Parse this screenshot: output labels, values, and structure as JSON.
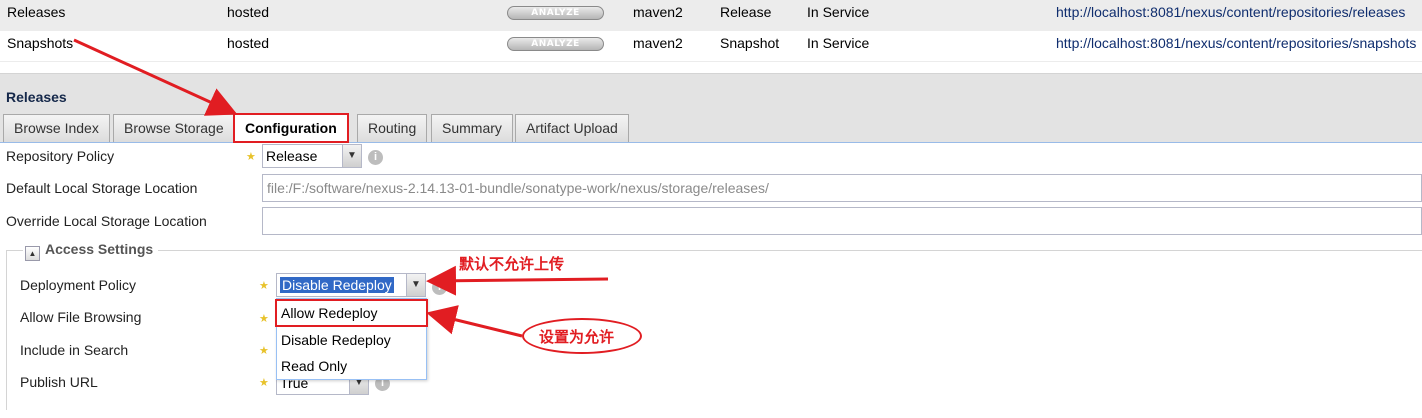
{
  "repositories": {
    "analyze_label": "ANALYZE",
    "rows": [
      {
        "name": "Releases",
        "type": "hosted",
        "format": "maven2",
        "policy": "Release",
        "status": "In Service",
        "url": "http://localhost:8081/nexus/content/repositories/releases"
      },
      {
        "name": "Snapshots",
        "type": "hosted",
        "format": "maven2",
        "policy": "Snapshot",
        "status": "In Service",
        "url": "http://localhost:8081/nexus/content/repositories/snapshots"
      }
    ]
  },
  "panel": {
    "title": "Releases",
    "tabs": [
      "Browse Index",
      "Browse Storage",
      "Configuration",
      "Routing",
      "Summary",
      "Artifact Upload"
    ],
    "active_tab": "Configuration"
  },
  "form": {
    "repository_policy": {
      "label": "Repository Policy",
      "value": "Release"
    },
    "default_storage": {
      "label": "Default Local Storage Location",
      "value": "file:/F:/software/nexus-2.14.13-01-bundle/sonatype-work/nexus/storage/releases/"
    },
    "override_storage": {
      "label": "Override Local Storage Location",
      "value": ""
    },
    "access_settings": {
      "legend": "Access Settings",
      "deployment_policy": {
        "label": "Deployment Policy",
        "value": "Disable Redeploy"
      },
      "allow_file_browsing": {
        "label": "Allow File Browsing"
      },
      "include_in_search": {
        "label": "Include in Search"
      },
      "publish_url": {
        "label": "Publish URL",
        "value": "True"
      }
    }
  },
  "dropdown": {
    "options": [
      "Allow Redeploy",
      "Disable Redeploy",
      "Read Only"
    ]
  },
  "annotations": {
    "default_note": "默认不允许上传",
    "set_note": "设置为允许"
  },
  "colors": {
    "annotation_red": "#e11d22",
    "selection_blue": "#3169c6",
    "link_blue": "#0f2d6e"
  }
}
